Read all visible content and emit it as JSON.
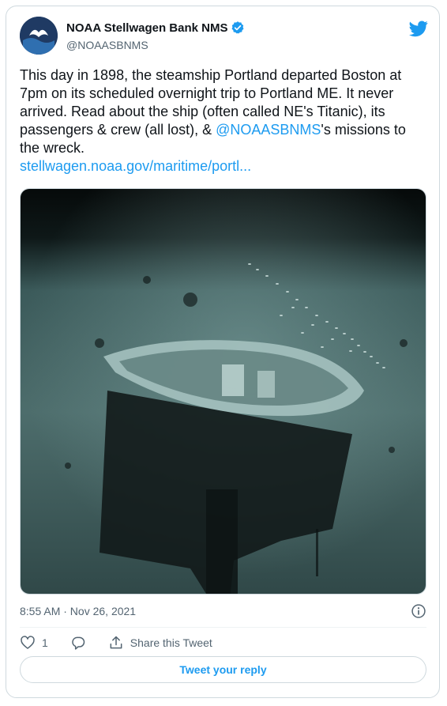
{
  "tweet": {
    "author_name": "NOAA Stellwagen Bank NMS",
    "author_handle": "@NOAASBNMS",
    "text_part1": "This day in 1898, the steamship Portland departed Boston at 7pm on its scheduled overnight trip to Portland ME. It never arrived. Read about the ship (often called NE's Titanic), its passengers & crew (all lost), & ",
    "mention": "@NOAASBNMS",
    "text_part2": "'s missions to the wreck.",
    "link": "stellwagen.noaa.gov/maritime/portl...",
    "timestamp": "8:55 AM · Nov 26, 2021",
    "like_count": "1",
    "share_label": "Share this Tweet",
    "reply_label": "Tweet your reply"
  },
  "colors": {
    "accent": "#1d9bf0",
    "secondary_text": "#536471",
    "border": "#cfd9de"
  },
  "icons": [
    "noaa-logo",
    "verified-badge-icon",
    "twitter-bird-icon",
    "info-icon",
    "heart-icon",
    "reply-icon",
    "share-icon"
  ]
}
